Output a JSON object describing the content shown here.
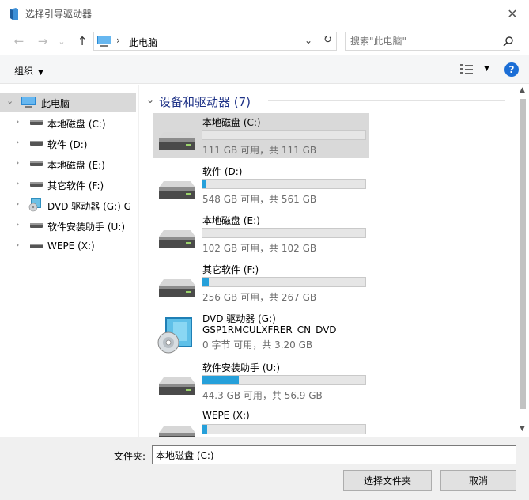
{
  "window": {
    "title": "选择引导驱动器",
    "close_glyph": "✕"
  },
  "nav": {
    "back_glyph": "←",
    "forward_glyph": "→",
    "recent_glyph": "⌄",
    "up_glyph": "↑",
    "address_sep": "›",
    "address_crumb": "此电脑",
    "address_drop": "⌄",
    "refresh_glyph": "↻",
    "search_placeholder": "搜索\"此电脑\""
  },
  "toolbar": {
    "organize_label": "组织",
    "organize_caret": "▼",
    "view_caret": "▼",
    "help_label": "?"
  },
  "tree": {
    "root_chev": "⌄",
    "root_label": "此电脑",
    "item_chev": "›",
    "items": [
      {
        "label": "本地磁盘 (C:)",
        "icon": "drive-icon"
      },
      {
        "label": "软件 (D:)",
        "icon": "drive-icon"
      },
      {
        "label": "本地磁盘 (E:)",
        "icon": "drive-icon"
      },
      {
        "label": "其它软件 (F:)",
        "icon": "drive-icon"
      },
      {
        "label": "DVD 驱动器 (G:) G",
        "icon": "dvd-icon"
      },
      {
        "label": "软件安装助手 (U:)",
        "icon": "drive-icon"
      },
      {
        "label": "WEPE (X:)",
        "icon": "drive-icon"
      }
    ]
  },
  "content": {
    "group_chev": "⌄",
    "group_title": "设备和驱动器 (7)",
    "drives": [
      {
        "name": "本地磁盘 (C:)",
        "free": "111 GB 可用，共 111 GB",
        "used_fraction": 0.0,
        "selected": true
      },
      {
        "name": "软件 (D:)",
        "free": "548 GB 可用，共 561 GB",
        "used_fraction": 0.023
      },
      {
        "name": "本地磁盘 (E:)",
        "free": "102 GB 可用，共 102 GB",
        "used_fraction": 0.0
      },
      {
        "name": "其它软件 (F:)",
        "free": "256 GB 可用，共 267 GB",
        "used_fraction": 0.041
      },
      {
        "name": "DVD 驱动器 (G:)",
        "name2": "GSP1RMCULXFRER_CN_DVD",
        "free": "0 字节 可用，共 3.20 GB",
        "type": "dvd"
      },
      {
        "name": "软件安装助手 (U:)",
        "free": "44.3 GB 可用，共 56.9 GB",
        "used_fraction": 0.221
      },
      {
        "name": "WEPE (X:)",
        "free": "",
        "used_fraction": 0.03
      }
    ]
  },
  "scroll": {
    "up_glyph": "▲",
    "down_glyph": "▼"
  },
  "footer": {
    "folder_label": "文件夹:",
    "folder_value": "本地磁盘 (C:)",
    "select_button": "选择文件夹",
    "cancel_button": "取消"
  },
  "colors": {
    "accent": "#26a0da",
    "help": "#1b6ed6",
    "group_title": "#1e3287"
  }
}
